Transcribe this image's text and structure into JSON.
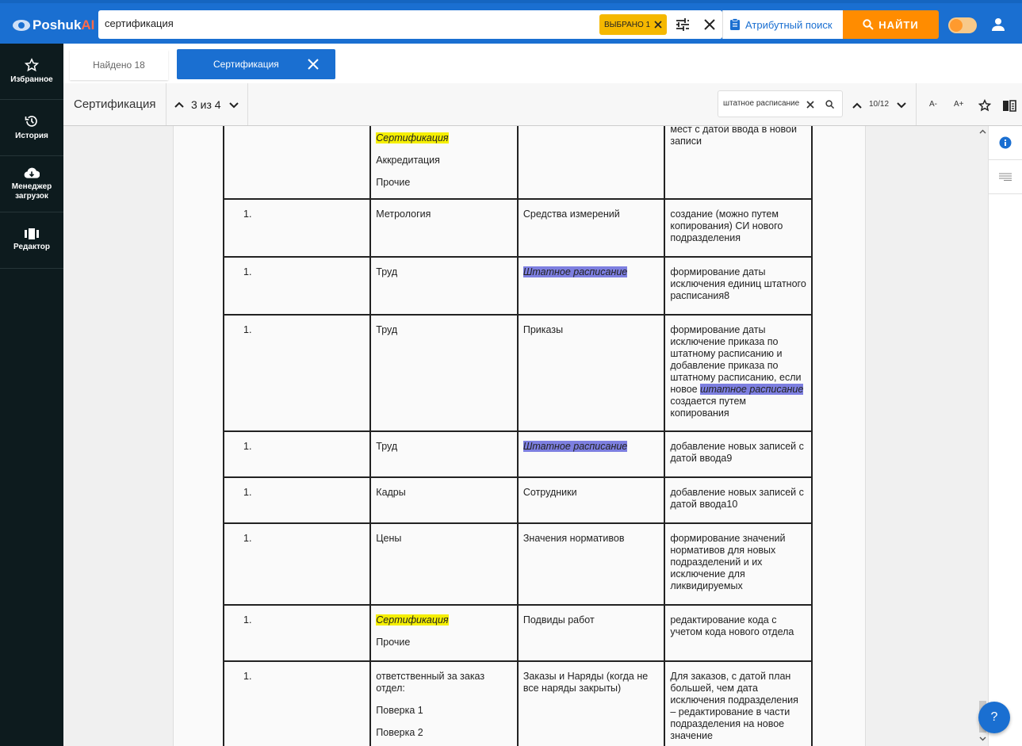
{
  "app": {
    "logo_main": "Poshuk",
    "logo_ai": "AI"
  },
  "search": {
    "value": "сертификация",
    "chip_label": "ВЫБРАНО 1",
    "attr_search_label": "Атрибутный поиск",
    "find_label": "НАЙТИ"
  },
  "sidebar": {
    "items": [
      {
        "label": "Избранное",
        "icon": "star-icon"
      },
      {
        "label": "История",
        "icon": "history-icon"
      },
      {
        "label": "Менеджер загрузок",
        "icon": "cloud-download-icon"
      },
      {
        "label": "Редактор",
        "icon": "editor-icon"
      }
    ]
  },
  "tabs": {
    "found": "Найдено 18",
    "active": "Сертификация"
  },
  "toolbar": {
    "doc_title": "Сертификация",
    "nav_count": "3 из 4",
    "find_value": "штатное расписание",
    "match_count": "10/12",
    "font_minus": "A-",
    "font_plus": "A+"
  },
  "table": {
    "rows": [
      {
        "num": "",
        "c2": [
          "Сертификация|y",
          "Аккредитация",
          "Прочие"
        ],
        "c3": [],
        "c4": [
          "мест с датой ввода в новой записи"
        ]
      },
      {
        "num": "1.",
        "c2": [
          "Метрология"
        ],
        "c3": [
          "Средства измерений"
        ],
        "c4": [
          "создание (можно путем копирования) СИ нового подразделения"
        ]
      },
      {
        "num": "1.",
        "c2": [
          "Труд"
        ],
        "c3": [
          "Штатное расписание|b"
        ],
        "c4": [
          "формирование даты исключения единиц штатного расписания8"
        ]
      },
      {
        "num": "1.",
        "c2": [
          "Труд"
        ],
        "c3": [
          "Приказы"
        ],
        "c4": [
          "формирование даты исключение приказа по штатному расписанию и добавление приказа по штатному расписанию, если новое ",
          "штатное расписание|b",
          " создается путем копирования"
        ]
      },
      {
        "num": "1.",
        "c2": [
          "Труд"
        ],
        "c3": [
          "Штатное расписание|b"
        ],
        "c4": [
          "добавление новых записей с датой ввода9"
        ]
      },
      {
        "num": "1.",
        "c2": [
          "Кадры"
        ],
        "c3": [
          "Сотрудники"
        ],
        "c4": [
          "добавление новых записей с датой ввода10"
        ]
      },
      {
        "num": "1.",
        "c2": [
          "Цены"
        ],
        "c3": [
          "Значения нормативов"
        ],
        "c4": [
          "формирование значений нормативов для новых подразделений и их исключение для ликвидируемых"
        ]
      },
      {
        "num": "1.",
        "c2": [
          "Сертификация|y",
          "Прочие"
        ],
        "c3": [
          "Подвиды работ"
        ],
        "c4": [
          "редактирование кода с учетом кода нового отдела"
        ]
      },
      {
        "num": "1.",
        "c2": [
          "ответственный за заказ отдел:",
          "Поверка 1",
          "Поверка 2"
        ],
        "c3": [
          "Заказы и Наряды (когда  не все наряды закрыты)"
        ],
        "c4": [
          "Для заказов, с датой план большей, чем дата исключения подразделения – редактирование в части подразделения на новое значение"
        ]
      }
    ]
  },
  "help_label": "?"
}
